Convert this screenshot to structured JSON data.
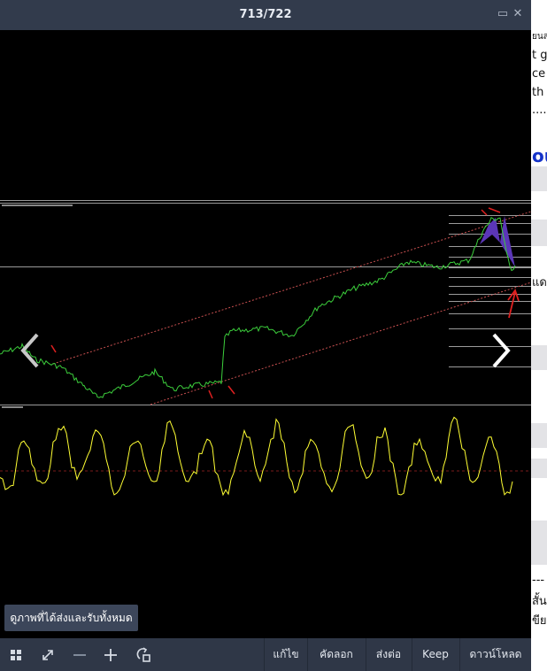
{
  "window": {
    "title": "713/722",
    "minimize_icon": "minimize-icon",
    "close_icon": "close-icon"
  },
  "colors": {
    "price": "#3ccf3c",
    "oscillator": "#ffff33",
    "channel": "#c85050",
    "fibo": "#cfcfcf",
    "harmonic": "#5b36b8"
  },
  "right_panel": {
    "lines": [
      "ยนส",
      "t g",
      "ce",
      "th",
      "....",
      "ou",
      "แด",
      "---",
      "สั้น",
      "ขีย"
    ]
  },
  "viewer": {
    "prev_icon": "chevron-left-icon",
    "next_icon": "chevron-right-icon"
  },
  "tooltip": "ดูภาพที่ได้ส่งและรับทั้งหมด",
  "toolbar": {
    "icons": [
      "grid-icon",
      "fullscreen-icon",
      "zoom-out-icon",
      "zoom-in-icon",
      "rotate-icon"
    ],
    "actions": {
      "edit": "แก้ไข",
      "copy": "คัดลอก",
      "forward": "ส่งต่อ",
      "keep": "Keep",
      "download": "ดาวน์โหลด"
    }
  }
}
